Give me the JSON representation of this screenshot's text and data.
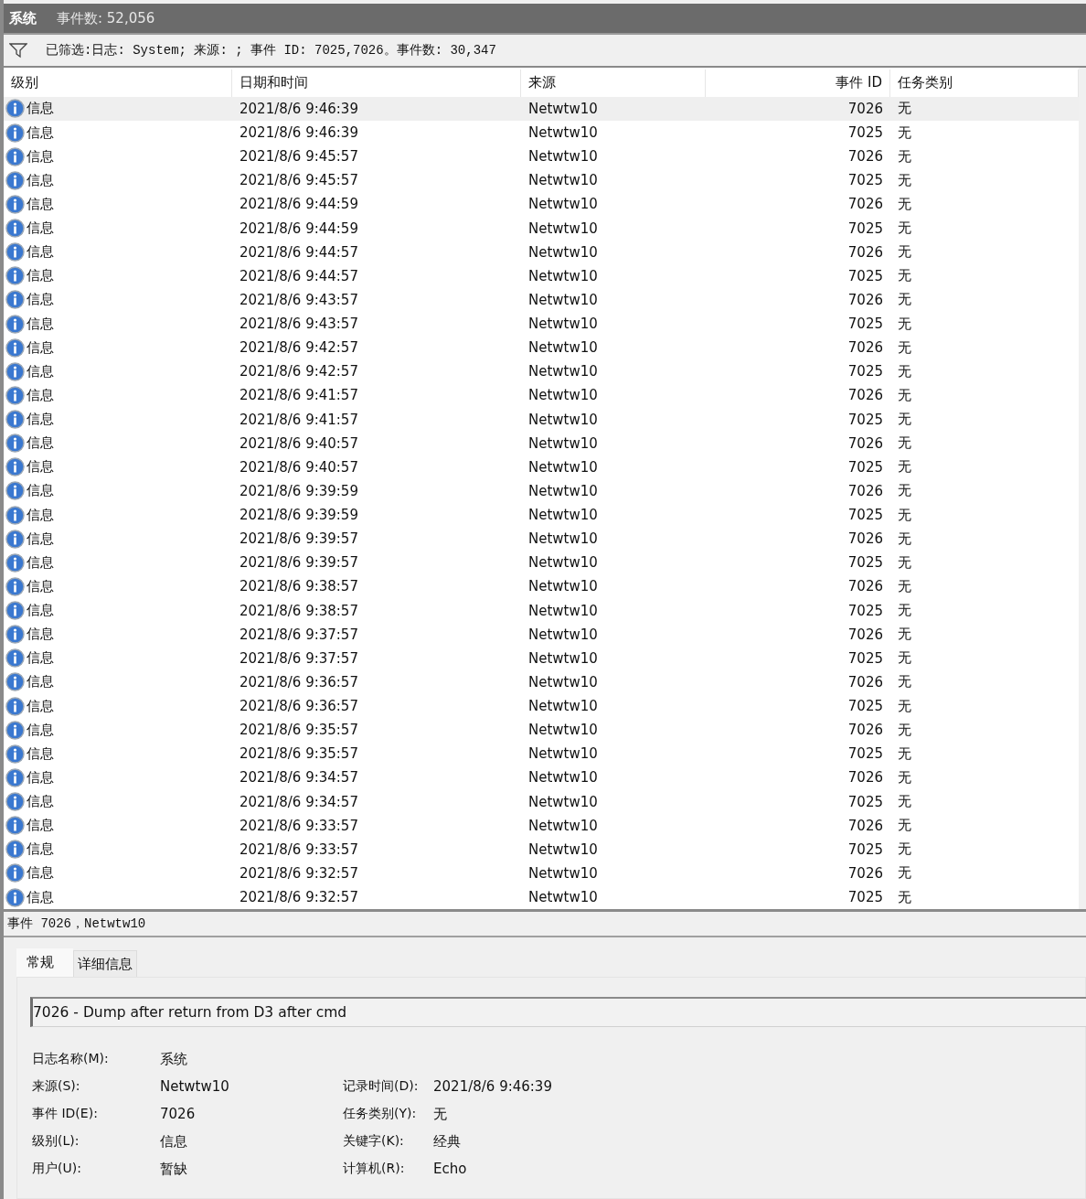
{
  "window": {
    "title": "系统",
    "event_count": "事件数: 52,056"
  },
  "filter": {
    "text": "已筛选:日志: System; 来源: ; 事件 ID: 7025,7026。事件数: 30,347"
  },
  "table": {
    "columns": [
      "级别",
      "日期和时间",
      "来源",
      "事件 ID",
      "任务类别"
    ],
    "rows": [
      {
        "level": "信息",
        "datetime": "2021/8/6 9:46:39",
        "source": "Netwtw10",
        "event_id": "7026",
        "category": "无",
        "selected": true
      },
      {
        "level": "信息",
        "datetime": "2021/8/6 9:46:39",
        "source": "Netwtw10",
        "event_id": "7025",
        "category": "无",
        "selected": false
      },
      {
        "level": "信息",
        "datetime": "2021/8/6 9:45:57",
        "source": "Netwtw10",
        "event_id": "7026",
        "category": "无",
        "selected": false
      },
      {
        "level": "信息",
        "datetime": "2021/8/6 9:45:57",
        "source": "Netwtw10",
        "event_id": "7025",
        "category": "无",
        "selected": false
      },
      {
        "level": "信息",
        "datetime": "2021/8/6 9:44:59",
        "source": "Netwtw10",
        "event_id": "7026",
        "category": "无",
        "selected": false
      },
      {
        "level": "信息",
        "datetime": "2021/8/6 9:44:59",
        "source": "Netwtw10",
        "event_id": "7025",
        "category": "无",
        "selected": false
      },
      {
        "level": "信息",
        "datetime": "2021/8/6 9:44:57",
        "source": "Netwtw10",
        "event_id": "7026",
        "category": "无",
        "selected": false
      },
      {
        "level": "信息",
        "datetime": "2021/8/6 9:44:57",
        "source": "Netwtw10",
        "event_id": "7025",
        "category": "无",
        "selected": false
      },
      {
        "level": "信息",
        "datetime": "2021/8/6 9:43:57",
        "source": "Netwtw10",
        "event_id": "7026",
        "category": "无",
        "selected": false
      },
      {
        "level": "信息",
        "datetime": "2021/8/6 9:43:57",
        "source": "Netwtw10",
        "event_id": "7025",
        "category": "无",
        "selected": false
      },
      {
        "level": "信息",
        "datetime": "2021/8/6 9:42:57",
        "source": "Netwtw10",
        "event_id": "7026",
        "category": "无",
        "selected": false
      },
      {
        "level": "信息",
        "datetime": "2021/8/6 9:42:57",
        "source": "Netwtw10",
        "event_id": "7025",
        "category": "无",
        "selected": false
      },
      {
        "level": "信息",
        "datetime": "2021/8/6 9:41:57",
        "source": "Netwtw10",
        "event_id": "7026",
        "category": "无",
        "selected": false
      },
      {
        "level": "信息",
        "datetime": "2021/8/6 9:41:57",
        "source": "Netwtw10",
        "event_id": "7025",
        "category": "无",
        "selected": false
      },
      {
        "level": "信息",
        "datetime": "2021/8/6 9:40:57",
        "source": "Netwtw10",
        "event_id": "7026",
        "category": "无",
        "selected": false
      },
      {
        "level": "信息",
        "datetime": "2021/8/6 9:40:57",
        "source": "Netwtw10",
        "event_id": "7025",
        "category": "无",
        "selected": false
      },
      {
        "level": "信息",
        "datetime": "2021/8/6 9:39:59",
        "source": "Netwtw10",
        "event_id": "7026",
        "category": "无",
        "selected": false
      },
      {
        "level": "信息",
        "datetime": "2021/8/6 9:39:59",
        "source": "Netwtw10",
        "event_id": "7025",
        "category": "无",
        "selected": false
      },
      {
        "level": "信息",
        "datetime": "2021/8/6 9:39:57",
        "source": "Netwtw10",
        "event_id": "7026",
        "category": "无",
        "selected": false
      },
      {
        "level": "信息",
        "datetime": "2021/8/6 9:39:57",
        "source": "Netwtw10",
        "event_id": "7025",
        "category": "无",
        "selected": false
      },
      {
        "level": "信息",
        "datetime": "2021/8/6 9:38:57",
        "source": "Netwtw10",
        "event_id": "7026",
        "category": "无",
        "selected": false
      },
      {
        "level": "信息",
        "datetime": "2021/8/6 9:38:57",
        "source": "Netwtw10",
        "event_id": "7025",
        "category": "无",
        "selected": false
      },
      {
        "level": "信息",
        "datetime": "2021/8/6 9:37:57",
        "source": "Netwtw10",
        "event_id": "7026",
        "category": "无",
        "selected": false
      },
      {
        "level": "信息",
        "datetime": "2021/8/6 9:37:57",
        "source": "Netwtw10",
        "event_id": "7025",
        "category": "无",
        "selected": false
      },
      {
        "level": "信息",
        "datetime": "2021/8/6 9:36:57",
        "source": "Netwtw10",
        "event_id": "7026",
        "category": "无",
        "selected": false
      },
      {
        "level": "信息",
        "datetime": "2021/8/6 9:36:57",
        "source": "Netwtw10",
        "event_id": "7025",
        "category": "无",
        "selected": false
      },
      {
        "level": "信息",
        "datetime": "2021/8/6 9:35:57",
        "source": "Netwtw10",
        "event_id": "7026",
        "category": "无",
        "selected": false
      },
      {
        "level": "信息",
        "datetime": "2021/8/6 9:35:57",
        "source": "Netwtw10",
        "event_id": "7025",
        "category": "无",
        "selected": false
      },
      {
        "level": "信息",
        "datetime": "2021/8/6 9:34:57",
        "source": "Netwtw10",
        "event_id": "7026",
        "category": "无",
        "selected": false
      },
      {
        "level": "信息",
        "datetime": "2021/8/6 9:34:57",
        "source": "Netwtw10",
        "event_id": "7025",
        "category": "无",
        "selected": false
      },
      {
        "level": "信息",
        "datetime": "2021/8/6 9:33:57",
        "source": "Netwtw10",
        "event_id": "7026",
        "category": "无",
        "selected": false
      },
      {
        "level": "信息",
        "datetime": "2021/8/6 9:33:57",
        "source": "Netwtw10",
        "event_id": "7025",
        "category": "无",
        "selected": false
      },
      {
        "level": "信息",
        "datetime": "2021/8/6 9:32:57",
        "source": "Netwtw10",
        "event_id": "7026",
        "category": "无",
        "selected": false
      },
      {
        "level": "信息",
        "datetime": "2021/8/6 9:32:57",
        "source": "Netwtw10",
        "event_id": "7025",
        "category": "无",
        "selected": false
      }
    ]
  },
  "event_panel": {
    "title": "事件 7026，Netwtw10",
    "tabs": [
      {
        "label": "常规",
        "selected": true
      },
      {
        "label": "详细信息",
        "selected": false
      }
    ],
    "message": "7026 - Dump after return from D3 after cmd",
    "details_left": [
      {
        "label": "日志名称(M):",
        "value": "系统"
      },
      {
        "label": "来源(S):",
        "value": "Netwtw10"
      },
      {
        "label": "事件 ID(E):",
        "value": "7026"
      },
      {
        "label": "级别(L):",
        "value": "信息"
      },
      {
        "label": "用户(U):",
        "value": "暂缺"
      }
    ],
    "details_right": [
      {
        "label": "记录时间(D):",
        "value": "2021/8/6 9:46:39"
      },
      {
        "label": "任务类别(Y):",
        "value": "无"
      },
      {
        "label": "关键字(K):",
        "value": "经典"
      },
      {
        "label": "计算机(R):",
        "value": "Echo"
      }
    ]
  }
}
